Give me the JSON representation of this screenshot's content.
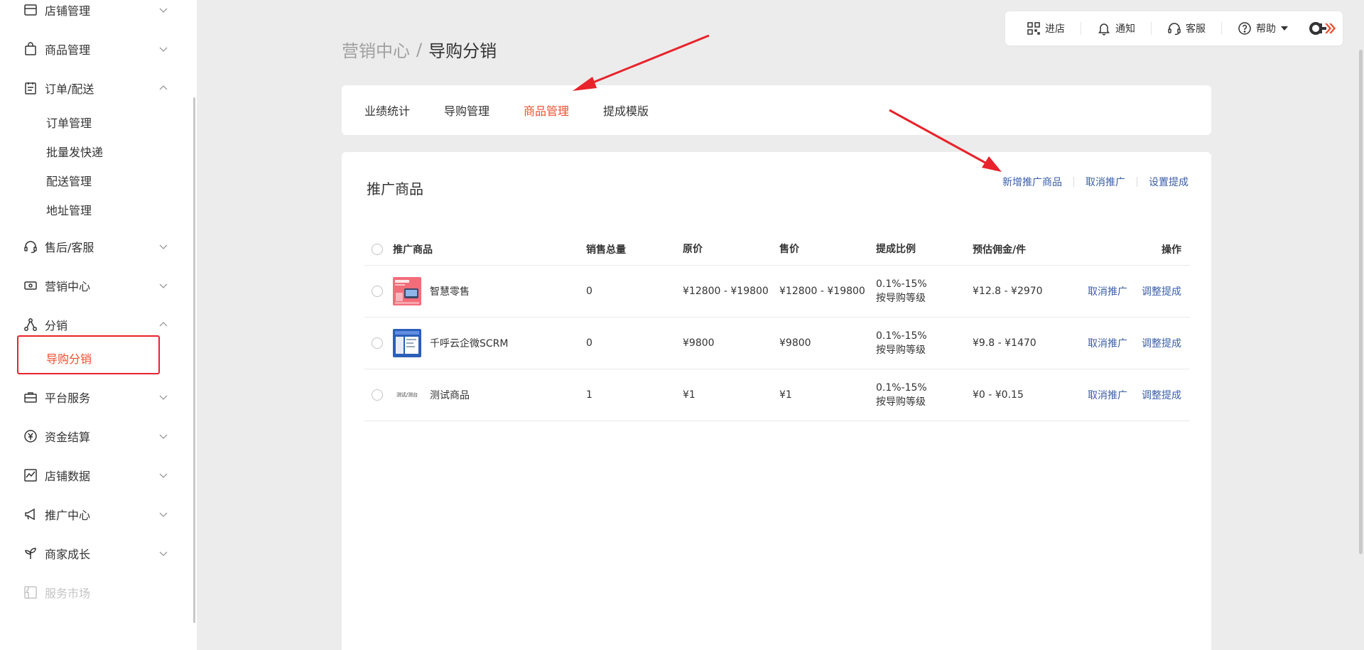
{
  "sidebar": {
    "items": [
      {
        "label": "店铺管理",
        "icon": "store-icon"
      },
      {
        "label": "商品管理",
        "icon": "shopping-bag-icon"
      },
      {
        "label": "订单/配送",
        "icon": "clipboard-icon"
      },
      {
        "label": "售后/客服",
        "icon": "headset-icon"
      },
      {
        "label": "营销中心",
        "icon": "ticket-icon"
      },
      {
        "label": "分销",
        "icon": "distribution-icon"
      },
      {
        "label": "平台服务",
        "icon": "briefcase-icon"
      },
      {
        "label": "资金结算",
        "icon": "yuan-icon"
      },
      {
        "label": "店铺数据",
        "icon": "chart-icon"
      },
      {
        "label": "推广中心",
        "icon": "megaphone-icon"
      },
      {
        "label": "商家成长",
        "icon": "sprout-icon"
      },
      {
        "label": "服务市场",
        "icon": "puzzle-icon"
      }
    ],
    "order_sub": [
      "订单管理",
      "批量发快递",
      "配送管理",
      "地址管理"
    ],
    "distribution_sub": [
      "导购分销"
    ]
  },
  "topbar": {
    "enter_store": "进店",
    "notify": "通知",
    "service": "客服",
    "help": "帮助"
  },
  "breadcrumb": {
    "parent": "营销中心",
    "separator": "/",
    "current": "导购分销"
  },
  "tabs": [
    "业绩统计",
    "导购管理",
    "商品管理",
    "提成模版"
  ],
  "active_tab": "商品管理",
  "card": {
    "title": "推广商品",
    "actions": [
      "新增推广商品",
      "取消推广",
      "设置提成"
    ]
  },
  "table": {
    "headers": [
      "推广商品",
      "销售总量",
      "原价",
      "售价",
      "提成比例",
      "预估佣金/件",
      "操作"
    ],
    "rows": [
      {
        "name": "智慧零售",
        "qty": "0",
        "orig": "¥12800 - ¥19800",
        "sale": "¥12800 - ¥19800",
        "rate": "0.1%-15%",
        "rate_note": "按导购等级",
        "est": "¥12.8 - ¥2970",
        "op1": "取消推广",
        "op2": "调整提成"
      },
      {
        "name": "千呼云企微SCRM",
        "qty": "0",
        "orig": "¥9800",
        "sale": "¥9800",
        "rate": "0.1%-15%",
        "rate_note": "按导购等级",
        "est": "¥9.8 - ¥1470",
        "op1": "取消推广",
        "op2": "调整提成"
      },
      {
        "name": "测试商品",
        "qty": "1",
        "orig": "¥1",
        "sale": "¥1",
        "rate": "0.1%-15%",
        "rate_note": "按导购等级",
        "est": "¥0 - ¥0.15",
        "op1": "取消推广",
        "op2": "调整提成",
        "thumb_text": "测试/测台"
      }
    ]
  },
  "colors": {
    "accent": "#ee4d2d",
    "link": "#3b5ea8",
    "annotation": "#e8232b"
  }
}
